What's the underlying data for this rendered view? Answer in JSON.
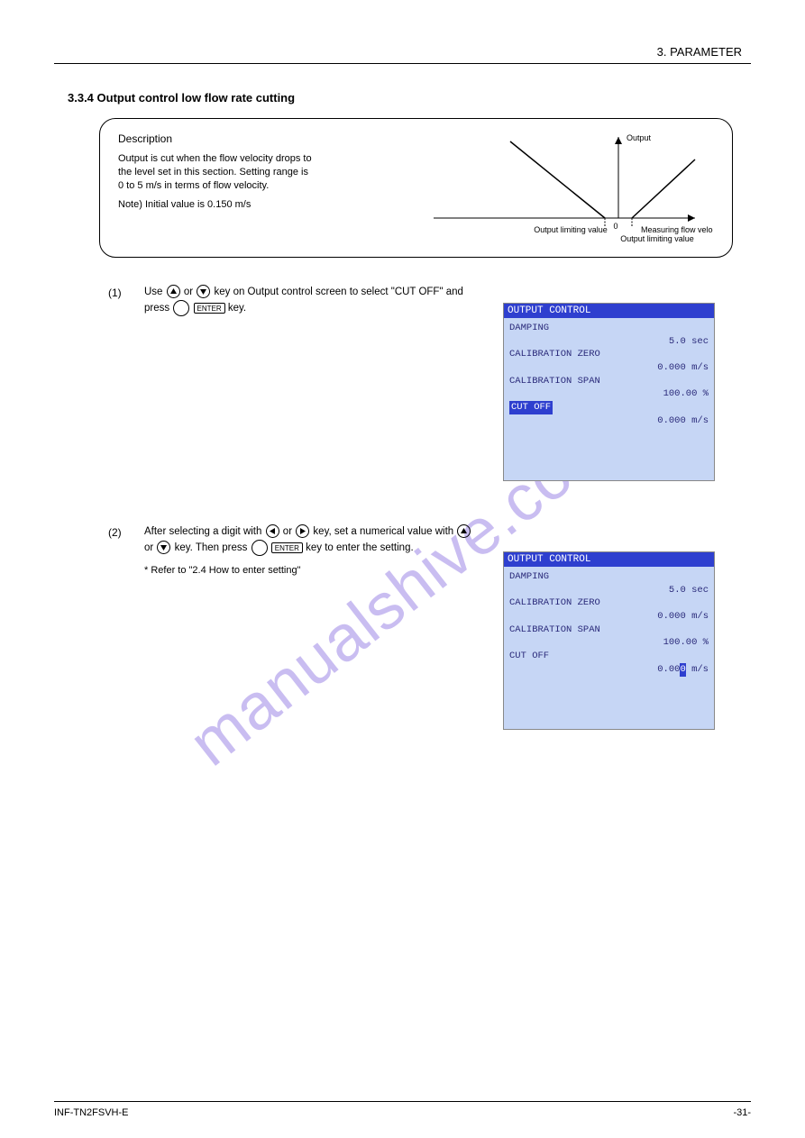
{
  "header": {
    "right_label": "3. PARAMETER"
  },
  "section": {
    "title": "3.3.4 Output control low flow rate cutting"
  },
  "desc": {
    "label": "Description",
    "text": "Output is cut when the flow velocity drops to\nthe level set in this section. Setting range is\n0 to 5 m/s in terms of flow velocity.",
    "note": "Note)  Initial value is 0.150 m/s"
  },
  "chart_data": {
    "type": "line",
    "axes": {
      "x_title": "Measuring flow velocity",
      "y_title": "Output",
      "marks": [
        "Output limiting value",
        "Output limiting value"
      ],
      "center_label": "0"
    },
    "series": [
      {
        "name": "left-v",
        "points": [
          [
            -1,
            1
          ],
          [
            -0.12,
            0
          ]
        ]
      },
      {
        "name": "right-v",
        "points": [
          [
            0.12,
            0
          ],
          [
            1,
            1
          ]
        ]
      },
      {
        "name": "center-up",
        "points": [
          [
            0,
            0
          ],
          [
            0,
            1.1
          ]
        ]
      }
    ]
  },
  "steps": [
    {
      "num": "(1)",
      "text_parts": [
        "Use ",
        "UP",
        " or ",
        "DN",
        " key on Output control screen to",
        "select \"CUT OFF\" and press ",
        "ENTER",
        " key."
      ]
    },
    {
      "num": "(2)",
      "text_parts": [
        "After selecting a digit with ",
        "LEFT",
        " or ",
        "RIGHT",
        " key, set a",
        "numerical value with ",
        "UP",
        " or ",
        "DN",
        " key. Then press",
        "ENTER",
        " key to enter the setting."
      ]
    }
  ],
  "screen1": {
    "title": "OUTPUT CONTROL",
    "rows": [
      {
        "left": "DAMPING",
        "right": ""
      },
      {
        "left": "",
        "right": "5.0 sec"
      },
      {
        "left": "CALIBRATION ZERO",
        "right": ""
      },
      {
        "left": "",
        "right": "0.000 m/s"
      },
      {
        "left": "CALIBRATION SPAN",
        "right": ""
      },
      {
        "left": "",
        "right": "100.00 %"
      },
      {
        "left_sel": "CUT OFF",
        "right": ""
      },
      {
        "left": "",
        "right": "0.000 m/s"
      }
    ]
  },
  "screen2": {
    "title": "OUTPUT CONTROL",
    "rows": [
      {
        "left": "DAMPING",
        "right": ""
      },
      {
        "left": "",
        "right": "5.0 sec"
      },
      {
        "left": "CALIBRATION ZERO",
        "right": ""
      },
      {
        "left": "",
        "right": "0.000 m/s"
      },
      {
        "left": "CALIBRATION SPAN",
        "right": ""
      },
      {
        "left": "",
        "right": "100.00 %"
      },
      {
        "left": "CUT OFF",
        "right": ""
      },
      {
        "left": "",
        "right_parts": [
          "0.00",
          "0",
          " m/s"
        ]
      }
    ]
  },
  "note_after_step2": "* Refer to \"2.4 How to enter setting\"",
  "footer": {
    "doc": "INF-TN2FSVH-E",
    "page": "-31-"
  },
  "watermark": "manualshive.com"
}
